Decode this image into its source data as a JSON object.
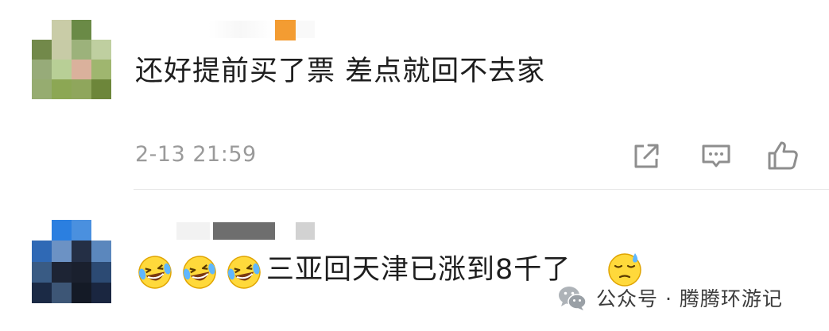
{
  "comments": [
    {
      "text": "还好提前买了票 差点就回不去家",
      "timestamp": "2-13 21:59",
      "actions": [
        "share-icon",
        "comment-icon",
        "like-icon"
      ]
    },
    {
      "text": "三亚回天津已涨到8千了",
      "emojis": [
        "laughing-crying-emoji",
        "laughing-crying-emoji",
        "laughing-crying-emoji",
        "sweat-sigh-emoji"
      ]
    }
  ],
  "watermark": {
    "text": "公众号 · 腾腾环游记"
  },
  "colors": {
    "text": "#1e1e1e",
    "meta": "#9a9a9a",
    "divider": "#e6e6e6",
    "name_badge": "#f39c32"
  }
}
